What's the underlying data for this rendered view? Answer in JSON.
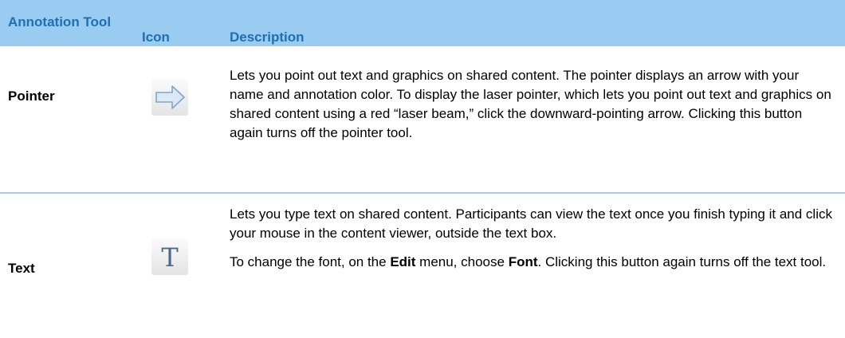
{
  "header": {
    "tool_label": "Annotation Tool",
    "icon_label": "Icon",
    "description_label": "Description"
  },
  "rows": [
    {
      "name": "Pointer",
      "icon": "right-arrow-icon",
      "description": [
        "Lets you point out text and graphics on shared content. The pointer displays an arrow with your name and annotation color. To display the laser pointer, which lets you point out text and graphics on shared content using a red “laser beam,” click the downward-pointing arrow. Clicking this button again turns off the pointer tool."
      ]
    },
    {
      "name": "Text",
      "icon": "text-t-icon",
      "description_p1": "Lets you type text on shared content. Participants can view the text once you finish typing it and click your mouse in the content viewer, outside the text box.",
      "description_p2": {
        "a": "To change the font, on the ",
        "b": "Edit",
        "c": " menu, choose ",
        "d": "Font",
        "e": ". Clicking this button again turns off the text tool."
      }
    }
  ]
}
